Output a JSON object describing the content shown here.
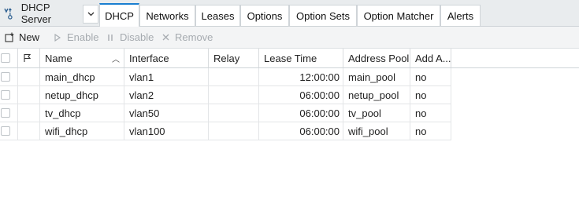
{
  "app": {
    "title": "DHCP Server",
    "icon": "dhcp-server-icon"
  },
  "tabs": [
    {
      "label": "DHCP",
      "active": true
    },
    {
      "label": "Networks",
      "active": false
    },
    {
      "label": "Leases",
      "active": false
    },
    {
      "label": "Options",
      "active": false
    },
    {
      "label": "Option Sets",
      "active": false
    },
    {
      "label": "Option Matcher",
      "active": false
    },
    {
      "label": "Alerts",
      "active": false
    }
  ],
  "toolbar": {
    "new_label": "New",
    "enable_label": "Enable",
    "disable_label": "Disable",
    "remove_label": "Remove"
  },
  "table": {
    "columns": [
      "Name",
      "Interface",
      "Relay",
      "Lease Time",
      "Address Pool",
      "Add A..."
    ],
    "rows": [
      {
        "name": "main_dhcp",
        "interface": "vlan1",
        "relay": "",
        "lease_time": "12:00:00",
        "address_pool": "main_pool",
        "add_arp": "no"
      },
      {
        "name": "netup_dhcp",
        "interface": "vlan2",
        "relay": "",
        "lease_time": "06:00:00",
        "address_pool": "netup_pool",
        "add_arp": "no"
      },
      {
        "name": "tv_dhcp",
        "interface": "vlan50",
        "relay": "",
        "lease_time": "06:00:00",
        "address_pool": "tv_pool",
        "add_arp": "no"
      },
      {
        "name": "wifi_dhcp",
        "interface": "vlan100",
        "relay": "",
        "lease_time": "06:00:00",
        "address_pool": "wifi_pool",
        "add_arp": "no"
      }
    ]
  },
  "colors": {
    "accent": "#1a7fd0"
  }
}
